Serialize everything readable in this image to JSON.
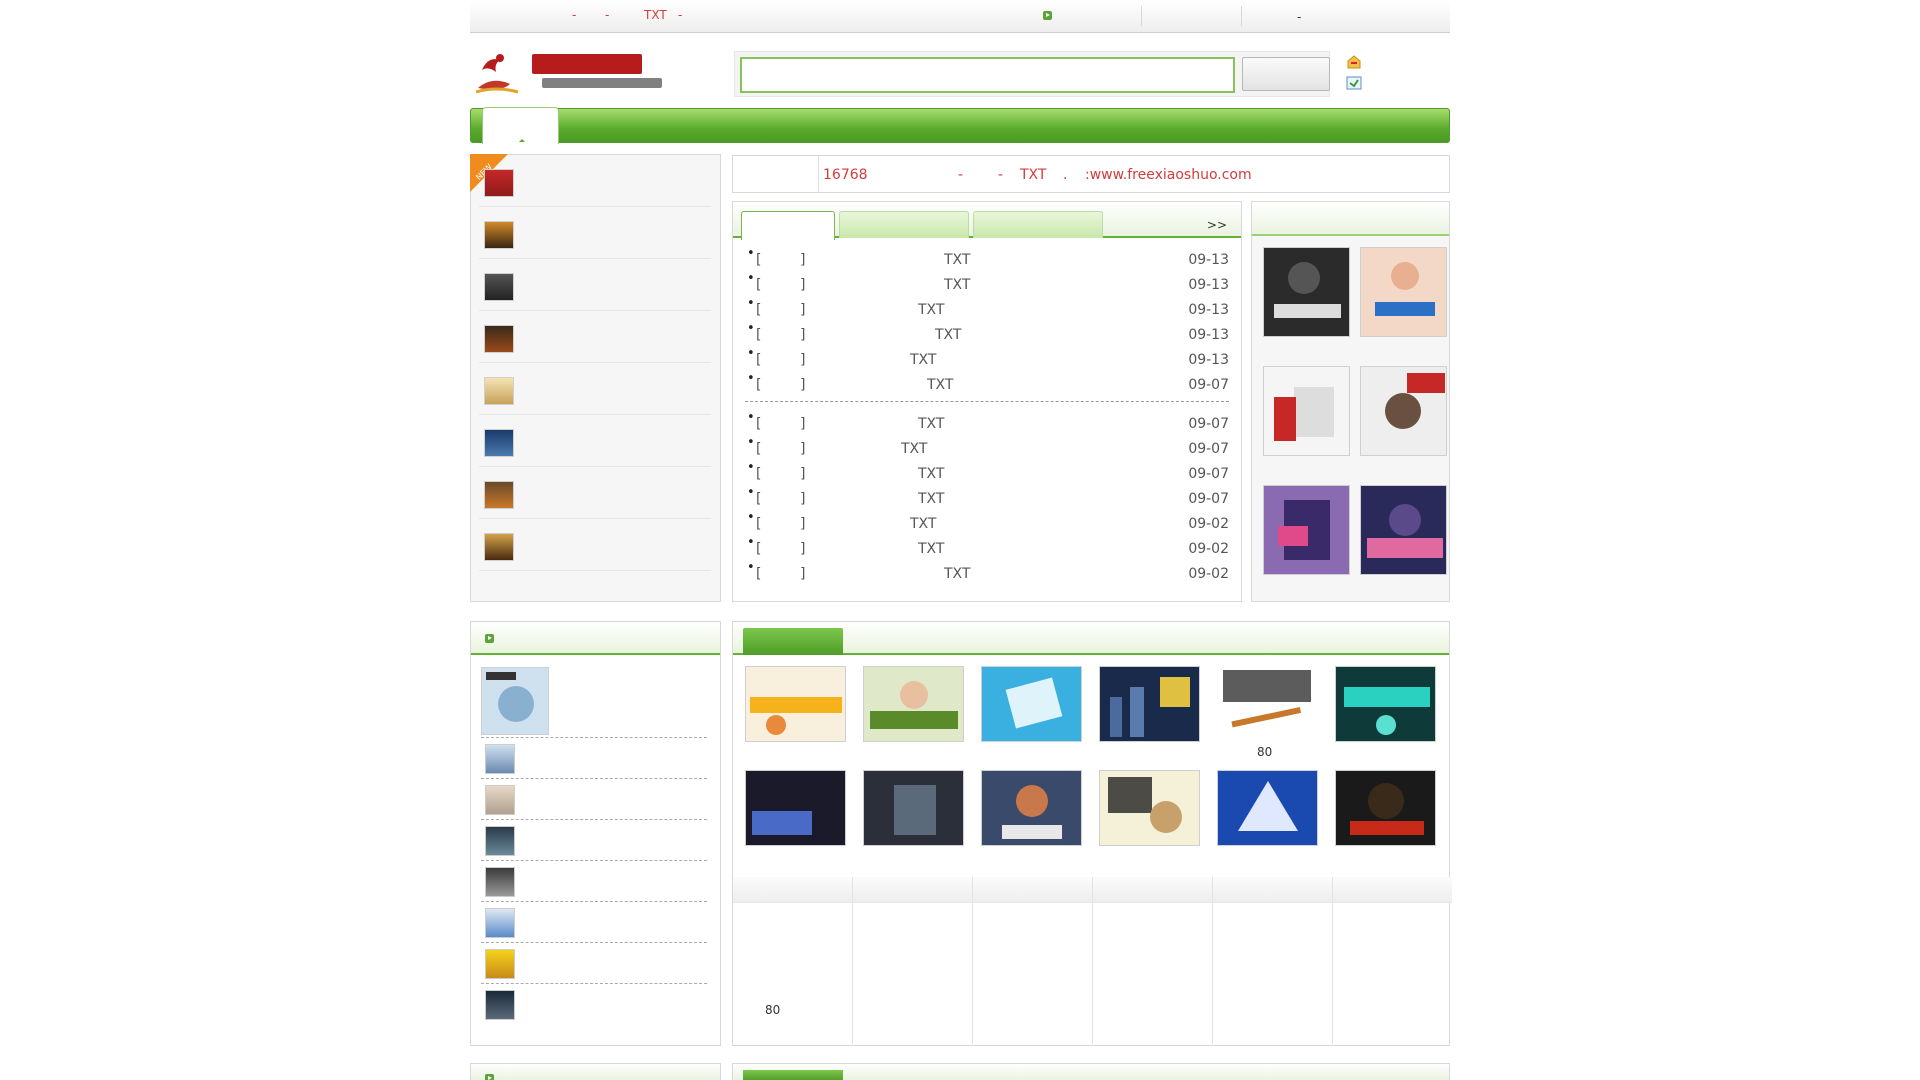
{
  "topbar": {
    "left_links": [
      {
        "text": "-",
        "x": "572"
      },
      {
        "text": "-",
        "x": "605"
      },
      {
        "text": "TXT",
        "x": "644"
      },
      {
        "text": "-",
        "x": "678"
      }
    ],
    "right_dash": "-"
  },
  "search": {
    "value": "",
    "button_label": ""
  },
  "notice": {
    "count": "16768",
    "parts": [
      "-",
      "-",
      "TXT",
      ".",
      ":www.freexiaoshuo.com"
    ]
  },
  "updates": {
    "more": ">>",
    "rows": [
      {
        "left": "[",
        "right": "]",
        "tag": "TXT",
        "date": "09-13"
      },
      {
        "left": "[",
        "right": "]",
        "tag": "TXT",
        "date": "09-13"
      },
      {
        "left": "[",
        "right": "]",
        "tag": "TXT",
        "date": "09-13"
      },
      {
        "left": "[",
        "right": "]",
        "tag": "TXT",
        "date": "09-13"
      },
      {
        "left": "[",
        "right": "]",
        "tag": "TXT",
        "date": "09-13"
      },
      {
        "left": "[",
        "right": "]",
        "tag": "TXT",
        "date": "09-07"
      },
      {
        "left": "[",
        "right": "]",
        "tag": "TXT",
        "date": "09-07"
      },
      {
        "left": "[",
        "right": "]",
        "tag": "TXT",
        "date": "09-07"
      },
      {
        "left": "[",
        "right": "]",
        "tag": "TXT",
        "date": "09-07"
      },
      {
        "left": "[",
        "right": "]",
        "tag": "TXT",
        "date": "09-07"
      },
      {
        "left": "[",
        "right": "]",
        "tag": "TXT",
        "date": "09-02"
      },
      {
        "left": "[",
        "right": "]",
        "tag": "TXT",
        "date": "09-02"
      },
      {
        "left": "[",
        "right": "]",
        "tag": "TXT",
        "date": "09-02"
      }
    ]
  },
  "grid": {
    "caption_80": "80",
    "cell_80": "80"
  },
  "colors": {
    "brand_green": "#5aa82b",
    "link_red": "#d43b3b"
  },
  "icons": [
    "logo-icon",
    "new-badge-icon",
    "bookmark-icon",
    "home-icon",
    "arrow-icon"
  ]
}
